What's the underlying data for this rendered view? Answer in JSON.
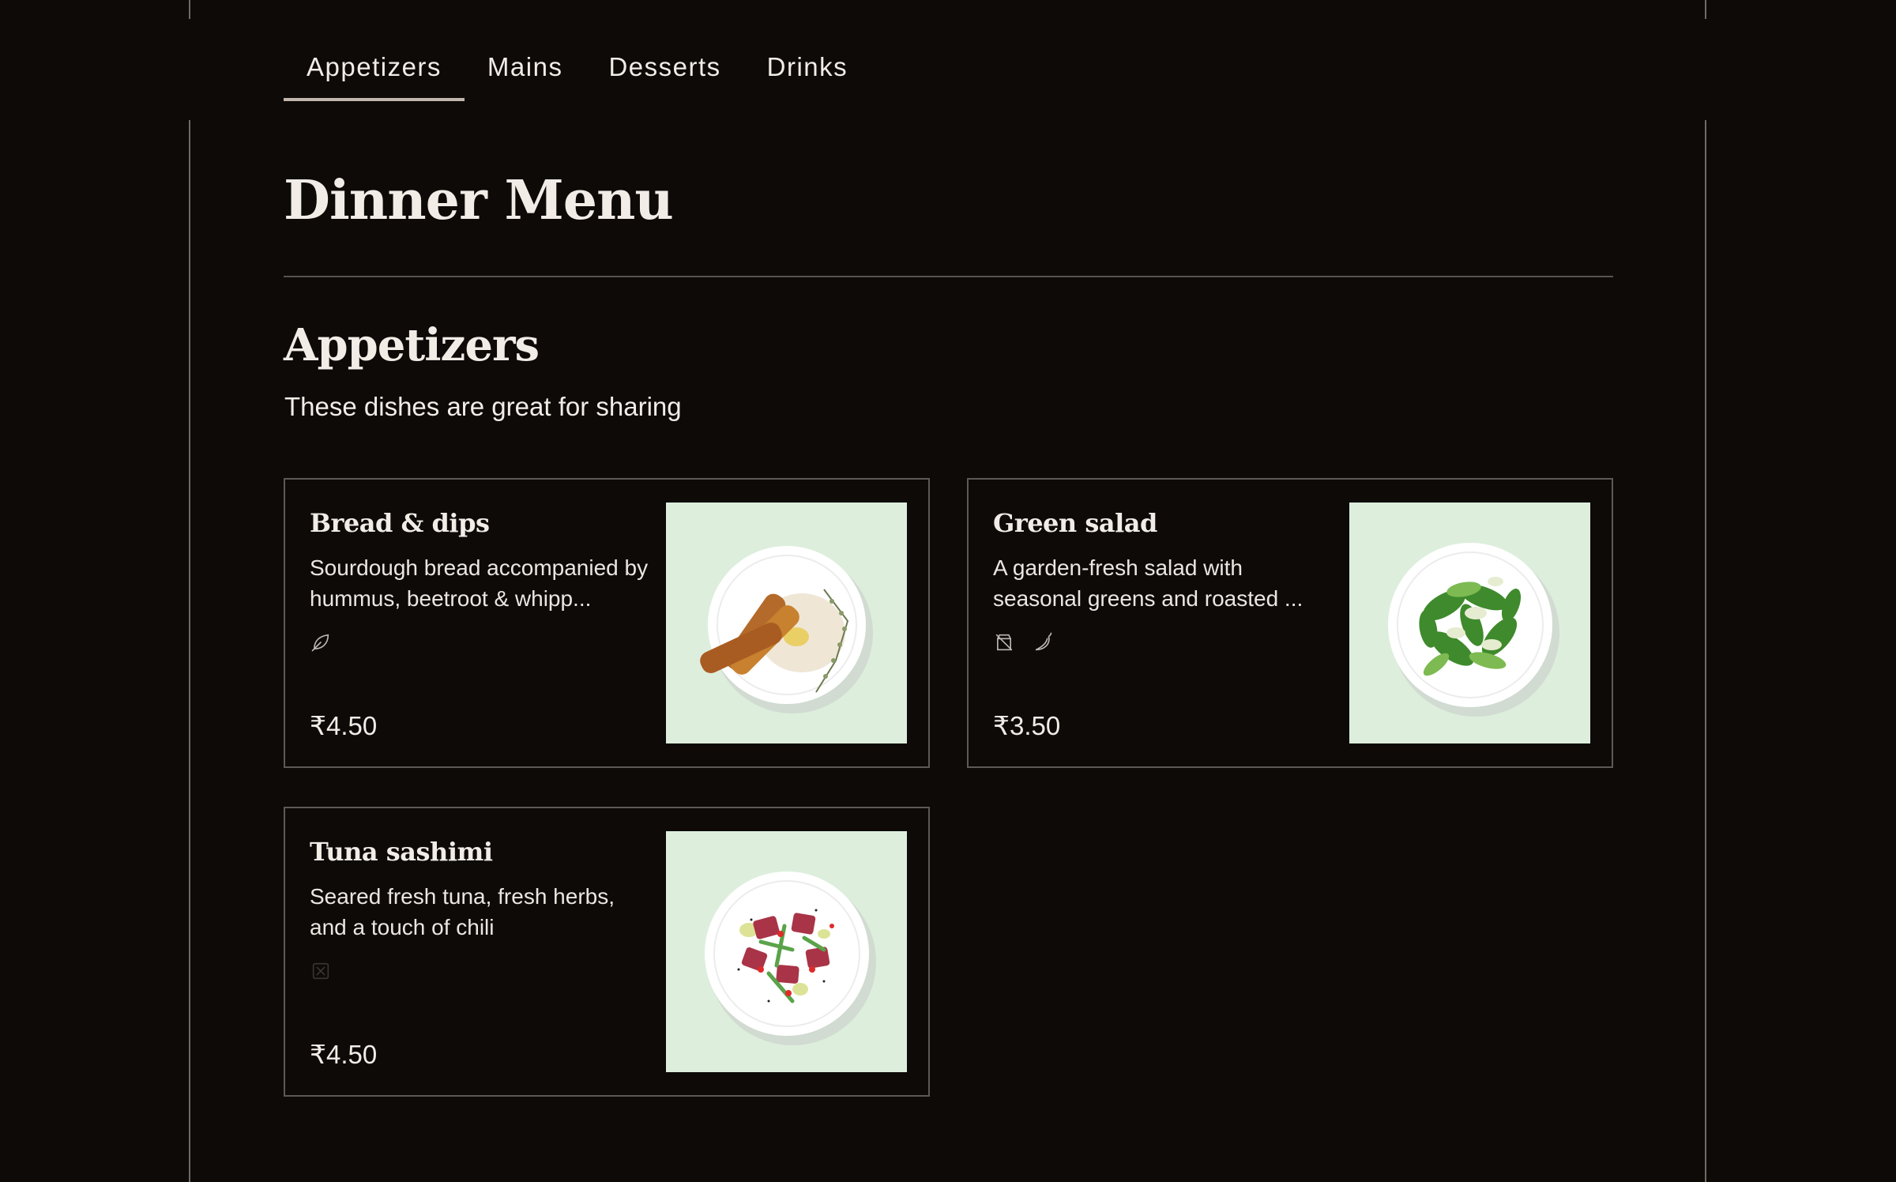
{
  "tabs": [
    {
      "label": "Appetizers",
      "active": true
    },
    {
      "label": "Mains",
      "active": false
    },
    {
      "label": "Desserts",
      "active": false
    },
    {
      "label": "Drinks",
      "active": false
    }
  ],
  "page": {
    "title": "Dinner Menu"
  },
  "section": {
    "title": "Appetizers",
    "subtitle": "These dishes are great for sharing"
  },
  "colors": {
    "background": "#0d0a08",
    "text": "#f1ece6",
    "border": "#5d5955",
    "tab_underline": "#c2b5ab",
    "photo_background": "#ddeedd"
  },
  "items": [
    {
      "name": "Bread & dips",
      "description": "Sourdough bread accompanied by hummus, beetroot & whipp...",
      "icons": [
        "leaf-icon"
      ],
      "price": "₹4.50"
    },
    {
      "name": "Green salad",
      "description": "A garden-fresh salad with seasonal greens and roasted ...",
      "icons": [
        "no-gluten-icon",
        "chili-icon"
      ],
      "price": "₹3.50"
    },
    {
      "name": "Tuna sashimi",
      "description": "Seared fresh tuna, fresh herbs, and a touch of chili",
      "icons": [
        "no-dairy-icon"
      ],
      "price": "₹4.50"
    }
  ]
}
